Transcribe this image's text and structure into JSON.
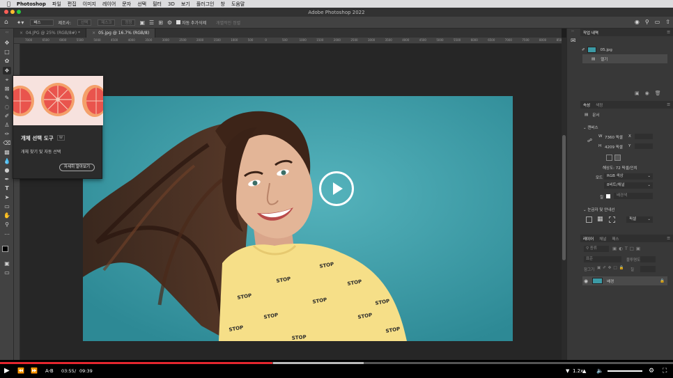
{
  "menubar": {
    "app": "Photoshop",
    "items": [
      "파일",
      "편집",
      "이미지",
      "레이어",
      "문자",
      "선택",
      "필터",
      "3D",
      "보기",
      "플러그인",
      "창",
      "도움말"
    ]
  },
  "window": {
    "title": "Adobe Photoshop 2022"
  },
  "options": {
    "mode": "빼스",
    "label_subject": "제조사:",
    "btn_a": "선택",
    "btn_b": "제스크",
    "btn_c": "정정",
    "auto_enhance": "자동 추가삭제",
    "dim_action": "개별적인 정렬"
  },
  "tabs": [
    {
      "label": "04.JPG @ 25% (RGB/8#) *"
    },
    {
      "label": "05.jpg @ 16.7% (RGB/8)"
    }
  ],
  "ruler": [
    "7000",
    "6500",
    "6000",
    "5500",
    "5000",
    "4500",
    "4000",
    "3500",
    "3000",
    "2500",
    "2000",
    "1500",
    "1000",
    "500",
    "0",
    "500",
    "1000",
    "1500",
    "2000",
    "2500",
    "3000",
    "3500",
    "4000",
    "4500",
    "5000",
    "5500",
    "6000",
    "6500",
    "7000",
    "7500",
    "8000",
    "8500"
  ],
  "tooltip": {
    "title": "개체 선택 도구",
    "shortcut": "W",
    "desc": "개체 찾기 및 자동 선택",
    "button": "자세히 알아보기"
  },
  "history": {
    "tab": "작업 내역",
    "file": "05.jpg",
    "step": "열기"
  },
  "properties": {
    "tab_a": "속성",
    "tab_b": "색정",
    "doc_label": "문서",
    "canvas": "캔버스",
    "w_label": "W",
    "w_value": "7360 픽셀",
    "x_label": "X",
    "h_label": "H",
    "h_value": "4209 픽셀",
    "y_label": "Y",
    "resolution": "해상도: 72 픽셀/인치",
    "mode_label": "모드",
    "mode_value": "RGB 색상",
    "depth_value": "8비트/채널",
    "fill_label": "칠",
    "fill_value": "배경색",
    "guides": "눈금자 및 안내선",
    "unit_value": "픽셀"
  },
  "layers": {
    "tab_a": "레이어",
    "tab_b": "채널",
    "tab_c": "패스",
    "kind": "종류",
    "mode": "표준",
    "opacity_label": "불투명도",
    "lock_label": "잠그기",
    "fill_label": "칠",
    "layer_name": "배경"
  },
  "video": {
    "current": "03:55",
    "separator": "/",
    "total": "09:39",
    "ab": "A-B",
    "speed": "1.2x",
    "progress": 0.405
  }
}
